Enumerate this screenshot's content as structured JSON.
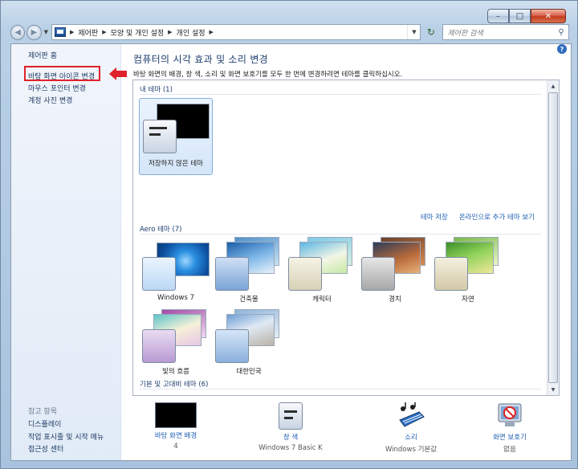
{
  "window": {
    "min": "–",
    "max": "□",
    "close": "✕"
  },
  "nav": {
    "back": "◀",
    "forward": "▶",
    "breadcrumb": [
      "제어판",
      "모양 및 개인 설정",
      "개인 설정"
    ],
    "search_placeholder": "제어판 검색"
  },
  "sidebar": {
    "home": "제어판 홈",
    "links": [
      "바탕 화면 아이콘 변경",
      "마우스 포인터 변경",
      "계정 사진 변경"
    ],
    "see_also_title": "참고 항목",
    "see_also": [
      "디스플레이",
      "작업 표시줄 및 시작 메뉴",
      "접근성 센터"
    ]
  },
  "main": {
    "title": "컴퓨터의 시각 효과 및 소리 변경",
    "description": "바탕 화면의 배경, 창 색, 소리 및 화면 보호기를 모두 한 번에 변경하려면 테마를 클릭하십시오.",
    "help": "?"
  },
  "my_themes": {
    "title": "내 테마 (1)",
    "items": [
      "저장하지 않은 테마"
    ],
    "save_link": "테마 저장",
    "online_link": "온라인으로 추가 테마 보기"
  },
  "aero_themes": {
    "title": "Aero 테마 (7)",
    "items": [
      "Windows 7",
      "건축물",
      "캐릭터",
      "경치",
      "자연",
      "빛의 흐름",
      "대한민국"
    ]
  },
  "basic_themes": {
    "title": "기본 및 고대비 테마 (6)"
  },
  "bottom": {
    "background": {
      "label": "바탕 화면 배경",
      "value": "4"
    },
    "color": {
      "label": "창 색",
      "value": "Windows 7 Basic K"
    },
    "sound": {
      "label": "소리",
      "value": "Windows 기본값"
    },
    "screensaver": {
      "label": "화면 보호기",
      "value": "없음"
    }
  },
  "colors": {
    "accent": "#1f5fb3",
    "highlight": "#e0212a"
  }
}
